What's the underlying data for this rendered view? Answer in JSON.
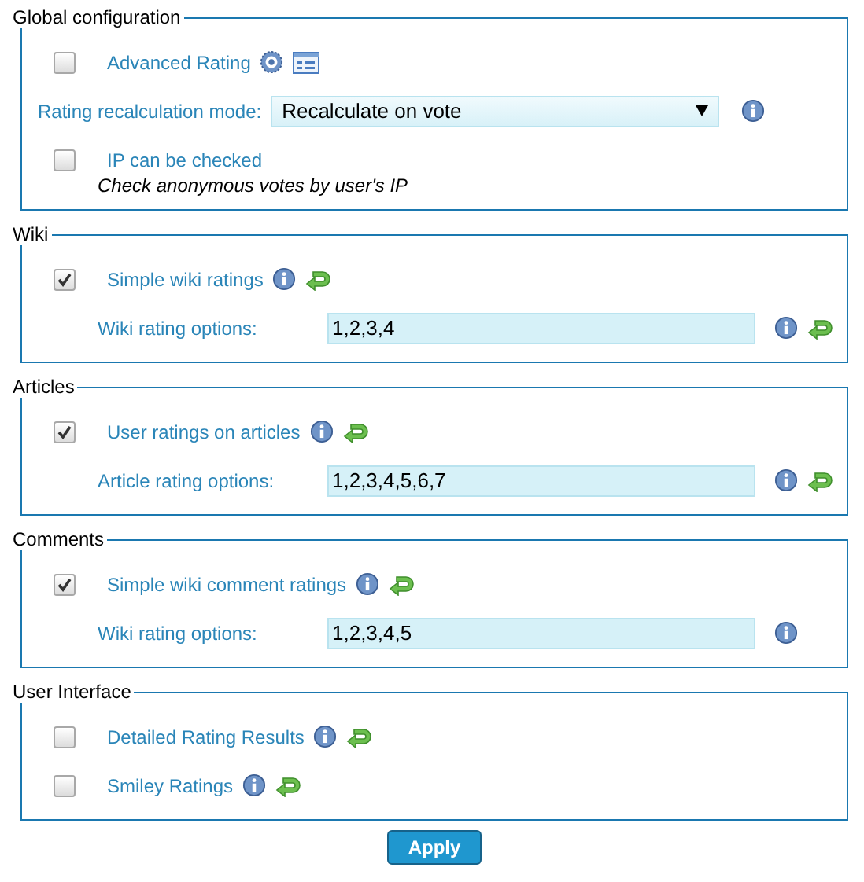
{
  "sections": [
    {
      "legend": "Global configuration",
      "rows": [
        {
          "kind": "checkbox",
          "label": "Advanced Rating",
          "checked": false,
          "help_icon": true,
          "form_icon": true
        },
        {
          "kind": "select",
          "label": "Rating recalculation mode:",
          "value": "Recalculate on vote",
          "info_icon": true
        },
        {
          "kind": "checkbox",
          "label": "IP can be checked",
          "checked": false,
          "note": "Check anonymous votes by user's IP"
        }
      ]
    },
    {
      "legend": "Wiki",
      "rows": [
        {
          "kind": "checkbox",
          "label": "Simple wiki ratings",
          "checked": true,
          "info_icon": true,
          "reset_icon": true
        },
        {
          "kind": "text",
          "label": "Wiki rating options:",
          "value": "1,2,3,4",
          "info_icon": true,
          "reset_icon": true
        }
      ]
    },
    {
      "legend": "Articles",
      "rows": [
        {
          "kind": "checkbox",
          "label": "User ratings on articles",
          "checked": true,
          "info_icon": true,
          "reset_icon": true
        },
        {
          "kind": "text",
          "label": "Article rating options:",
          "value": "1,2,3,4,5,6,7",
          "info_icon": true,
          "reset_icon": true
        }
      ]
    },
    {
      "legend": "Comments",
      "rows": [
        {
          "kind": "checkbox",
          "label": "Simple wiki comment ratings",
          "checked": true,
          "info_icon": true,
          "reset_icon": true
        },
        {
          "kind": "text",
          "label": "Wiki rating options:",
          "value": "1,2,3,4,5",
          "info_icon": true
        }
      ]
    },
    {
      "legend": "User Interface",
      "rows": [
        {
          "kind": "checkbox",
          "label": "Detailed Rating Results",
          "checked": false,
          "info_icon": true,
          "reset_icon": true
        },
        {
          "kind": "checkbox",
          "label": "Smiley Ratings",
          "checked": false,
          "info_icon": true,
          "reset_icon": true
        }
      ]
    }
  ],
  "apply_button": "Apply"
}
